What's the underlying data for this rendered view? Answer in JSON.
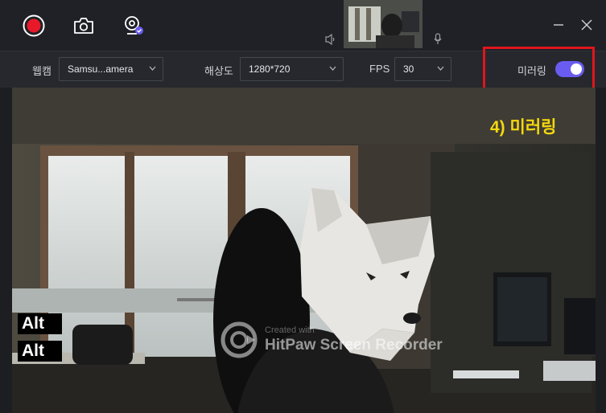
{
  "topbar": {
    "record_icon": "record-icon",
    "screenshot_icon": "camera-icon",
    "webcam_icon": "webcam-settings-icon",
    "speaker_icon": "speaker-icon",
    "mic_icon": "microphone-icon",
    "minimize_icon": "minimize-icon",
    "close_icon": "close-icon"
  },
  "settings": {
    "webcam_label": "웹캠",
    "webcam_value": "Samsu...amera",
    "resolution_label": "해상도",
    "resolution_value": "1280*720",
    "fps_label": "FPS",
    "fps_value": "30",
    "mirror_label": "미러링",
    "mirror_on": true
  },
  "overlay": {
    "annotation": "4) 미러링",
    "key1": "Alt",
    "key2": "Alt",
    "watermark_small": "Created with",
    "watermark_large": "HitPaw Screen Recorder"
  },
  "colors": {
    "accent": "#6a5cf0",
    "record": "#e81a2a",
    "highlight": "#e0161c",
    "annotation": "#f5d80c"
  }
}
